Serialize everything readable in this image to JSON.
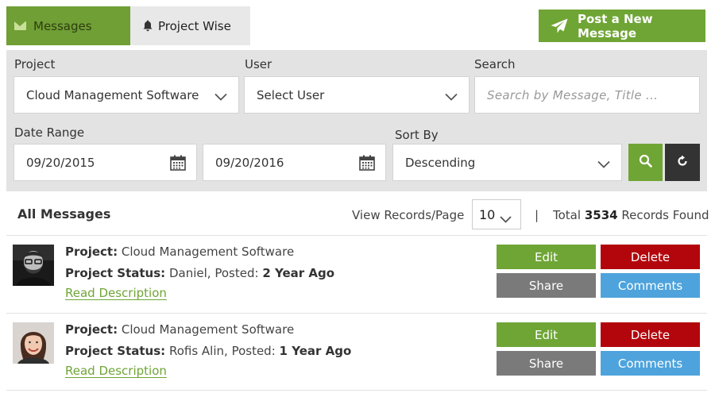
{
  "tabs": {
    "messages_label": "Messages",
    "project_wise_label": "Project Wise"
  },
  "post_button_label": "Post a New Message",
  "filters": {
    "project_label": "Project",
    "project_value": "Cloud Management Software",
    "user_label": "User",
    "user_value": "Select User",
    "search_label": "Search",
    "search_placeholder": "Search by Message, Title ...",
    "date_range_label": "Date Range",
    "date_from": "09/20/2015",
    "date_to": "09/20/2016",
    "sort_label": "Sort By",
    "sort_value": "Descending"
  },
  "list": {
    "title": "All Messages",
    "view_records_label": "View Records/Page",
    "records_per_page": "10",
    "separator": "|",
    "total_prefix": "Total",
    "total_count": "3534",
    "total_suffix": "Records Found"
  },
  "messages": [
    {
      "project_label": "Project:",
      "project": "Cloud Management Software",
      "status_label": "Project Status:",
      "author": "Daniel,",
      "posted_label": "Posted:",
      "posted": "2 Year Ago",
      "read_link": "Read Description",
      "edit": "Edit",
      "delete": "Delete",
      "share": "Share",
      "comments": "Comments"
    },
    {
      "project_label": "Project:",
      "project": "Cloud Management Software",
      "status_label": "Project Status:",
      "author": "Rofis Alin,",
      "posted_label": "Posted:",
      "posted": "1 Year Ago",
      "read_link": "Read Description",
      "edit": "Edit",
      "delete": "Delete",
      "share": "Share",
      "comments": "Comments"
    }
  ],
  "colors": {
    "accent_green": "#6fa535",
    "delete_red": "#b3060c",
    "share_gray": "#7a7a7a",
    "comments_blue": "#4ea3dc"
  },
  "icons": [
    "envelope-icon",
    "bell-icon",
    "paper-plane-icon",
    "chevron-down-icon",
    "calendar-icon",
    "search-icon",
    "refresh-icon"
  ]
}
